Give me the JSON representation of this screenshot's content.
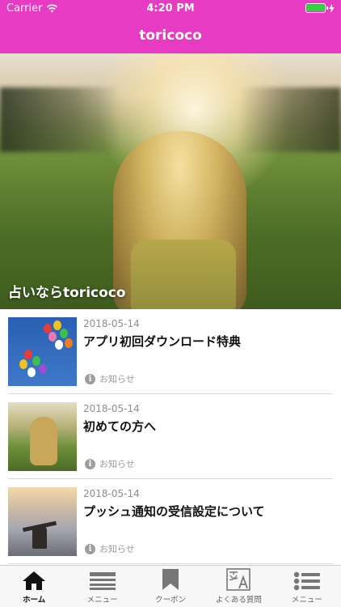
{
  "status_bar": {
    "carrier": "Carrier",
    "time": "4:20 PM",
    "battery_color": "#34d23c"
  },
  "nav": {
    "title": "toricoco",
    "bar_color": "#e63bc2"
  },
  "hero": {
    "caption": "占いならtoricoco"
  },
  "articles": [
    {
      "date": "2018-05-14",
      "title": "アプリ初回ダウンロード特典",
      "category": "お知らせ",
      "thumbnail": "balloons"
    },
    {
      "date": "2018-05-14",
      "title": "初めての方へ",
      "category": "お知らせ",
      "thumbnail": "girl-in-field"
    },
    {
      "date": "2018-05-14",
      "title": "プッシュ通知の受信設定について",
      "category": "お知らせ",
      "thumbnail": "person-in-clouds"
    }
  ],
  "tabs": [
    {
      "label": "ホーム",
      "icon": "home-icon",
      "active": true
    },
    {
      "label": "メニュー",
      "icon": "menu-lines-icon",
      "active": false
    },
    {
      "label": "クーポン",
      "icon": "bookmark-icon",
      "active": false
    },
    {
      "label": "よくある質問",
      "icon": "translate-faq-icon",
      "active": false
    },
    {
      "label": "メニュー",
      "icon": "list-icon",
      "active": false
    }
  ]
}
